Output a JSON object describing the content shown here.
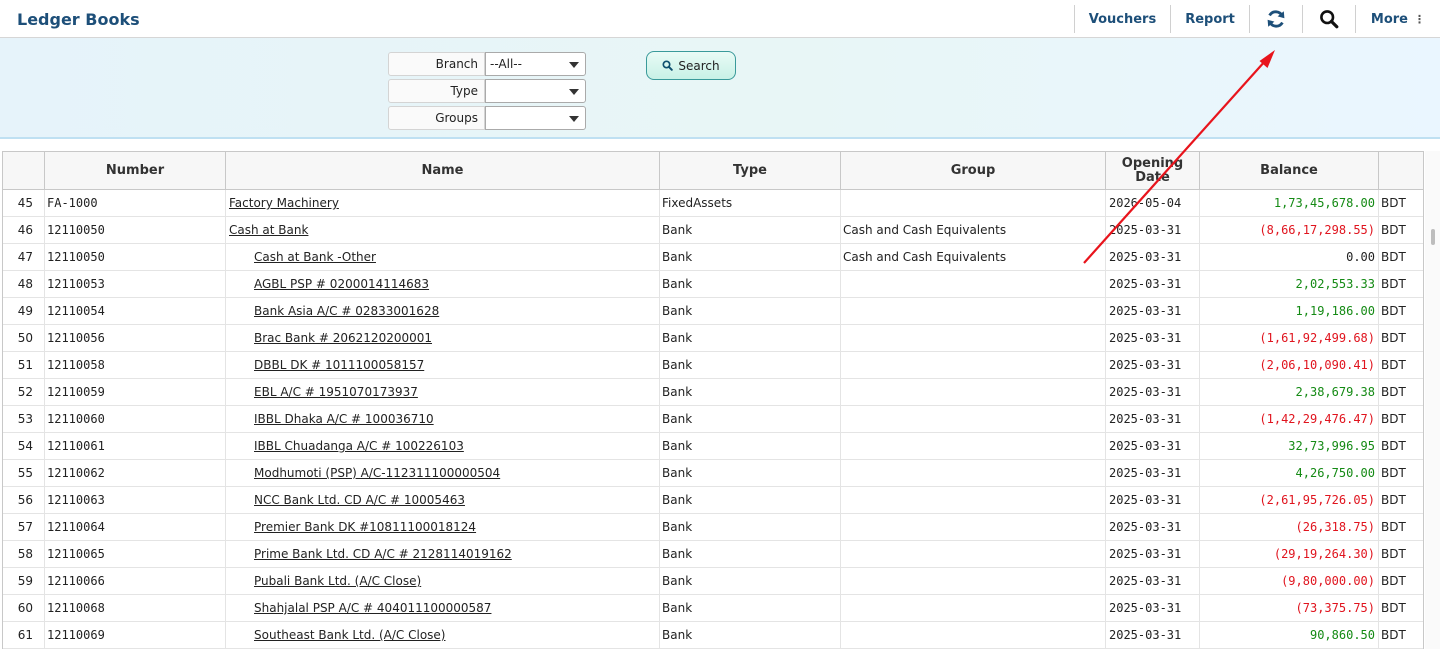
{
  "header": {
    "title": "Ledger Books",
    "nav": {
      "vouchers": "Vouchers",
      "report": "Report",
      "refresh_icon": "refresh-icon",
      "search_icon": "search-icon",
      "more": "More",
      "more_icon": "vertical-dots-icon"
    }
  },
  "filters": {
    "branch_label": "Branch",
    "branch_value": "--All--",
    "type_label": "Type",
    "type_value": "",
    "groups_label": "Groups",
    "groups_value": "",
    "search_button": "Search"
  },
  "table": {
    "columns": {
      "index": "",
      "number": "Number",
      "name": "Name",
      "type": "Type",
      "group": "Group",
      "opening_date": "Opening Date",
      "balance": "Balance",
      "currency": ""
    },
    "rows": [
      {
        "idx": "45",
        "number": "FA-1000",
        "name": "Factory Machinery",
        "indent": 0,
        "type": "FixedAssets",
        "group": "",
        "date": "2026-05-04",
        "balance": "1,73,45,678.00",
        "sign": "pos",
        "currency": "BDT"
      },
      {
        "idx": "46",
        "number": "12110050",
        "name": "Cash at Bank",
        "indent": 0,
        "type": "Bank",
        "group": "Cash and Cash Equivalents",
        "date": "2025-03-31",
        "balance": "(8,66,17,298.55)",
        "sign": "neg",
        "currency": "BDT"
      },
      {
        "idx": "47",
        "number": "12110050",
        "name": "Cash at Bank -Other",
        "indent": 1,
        "type": "Bank",
        "group": "Cash and Cash Equivalents",
        "date": "2025-03-31",
        "balance": "0.00",
        "sign": "zero",
        "currency": "BDT"
      },
      {
        "idx": "48",
        "number": "12110053",
        "name": "AGBL PSP # 0200014114683",
        "indent": 1,
        "type": "Bank",
        "group": "",
        "date": "2025-03-31",
        "balance": "2,02,553.33",
        "sign": "pos",
        "currency": "BDT"
      },
      {
        "idx": "49",
        "number": "12110054",
        "name": "Bank Asia A/C # 02833001628",
        "indent": 1,
        "type": "Bank",
        "group": "",
        "date": "2025-03-31",
        "balance": "1,19,186.00",
        "sign": "pos",
        "currency": "BDT"
      },
      {
        "idx": "50",
        "number": "12110056",
        "name": "Brac Bank # 2062120200001",
        "indent": 1,
        "type": "Bank",
        "group": "",
        "date": "2025-03-31",
        "balance": "(1,61,92,499.68)",
        "sign": "neg",
        "currency": "BDT"
      },
      {
        "idx": "51",
        "number": "12110058",
        "name": "DBBL DK # 1011100058157",
        "indent": 1,
        "type": "Bank",
        "group": "",
        "date": "2025-03-31",
        "balance": "(2,06,10,090.41)",
        "sign": "neg",
        "currency": "BDT"
      },
      {
        "idx": "52",
        "number": "12110059",
        "name": "EBL A/C # 1951070173937",
        "indent": 1,
        "type": "Bank",
        "group": "",
        "date": "2025-03-31",
        "balance": "2,38,679.38",
        "sign": "pos",
        "currency": "BDT"
      },
      {
        "idx": "53",
        "number": "12110060",
        "name": "IBBL Dhaka A/C # 100036710",
        "indent": 1,
        "type": "Bank",
        "group": "",
        "date": "2025-03-31",
        "balance": "(1,42,29,476.47)",
        "sign": "neg",
        "currency": "BDT"
      },
      {
        "idx": "54",
        "number": "12110061",
        "name": "IBBL Chuadanga A/C # 100226103",
        "indent": 1,
        "type": "Bank",
        "group": "",
        "date": "2025-03-31",
        "balance": "32,73,996.95",
        "sign": "pos",
        "currency": "BDT"
      },
      {
        "idx": "55",
        "number": "12110062",
        "name": "Modhumoti (PSP) A/C-112311100000504",
        "indent": 1,
        "type": "Bank",
        "group": "",
        "date": "2025-03-31",
        "balance": "4,26,750.00",
        "sign": "pos",
        "currency": "BDT"
      },
      {
        "idx": "56",
        "number": "12110063",
        "name": "NCC Bank Ltd. CD A/C # 10005463",
        "indent": 1,
        "type": "Bank",
        "group": "",
        "date": "2025-03-31",
        "balance": "(2,61,95,726.05)",
        "sign": "neg",
        "currency": "BDT"
      },
      {
        "idx": "57",
        "number": "12110064",
        "name": "Premier Bank DK #10811100018124",
        "indent": 1,
        "type": "Bank",
        "group": "",
        "date": "2025-03-31",
        "balance": "(26,318.75)",
        "sign": "neg",
        "currency": "BDT"
      },
      {
        "idx": "58",
        "number": "12110065",
        "name": "Prime Bank Ltd. CD A/C # 2128114019162",
        "indent": 1,
        "type": "Bank",
        "group": "",
        "date": "2025-03-31",
        "balance": "(29,19,264.30)",
        "sign": "neg",
        "currency": "BDT"
      },
      {
        "idx": "59",
        "number": "12110066",
        "name": "Pubali Bank Ltd. (A/C Close)",
        "indent": 1,
        "type": "Bank",
        "group": "",
        "date": "2025-03-31",
        "balance": "(9,80,000.00)",
        "sign": "neg",
        "currency": "BDT"
      },
      {
        "idx": "60",
        "number": "12110068",
        "name": "Shahjalal PSP A/C # 404011100000587",
        "indent": 1,
        "type": "Bank",
        "group": "",
        "date": "2025-03-31",
        "balance": "(73,375.75)",
        "sign": "neg",
        "currency": "BDT"
      },
      {
        "idx": "61",
        "number": "12110069",
        "name": "Southeast Bank Ltd. (A/C Close)",
        "indent": 1,
        "type": "Bank",
        "group": "",
        "date": "2025-03-31",
        "balance": "90,860.50",
        "sign": "pos",
        "currency": "BDT"
      }
    ]
  },
  "colors": {
    "brand": "#1d4f79",
    "positive": "#148a14",
    "negative": "#e0141e",
    "annotation_arrow": "#e8141c"
  }
}
